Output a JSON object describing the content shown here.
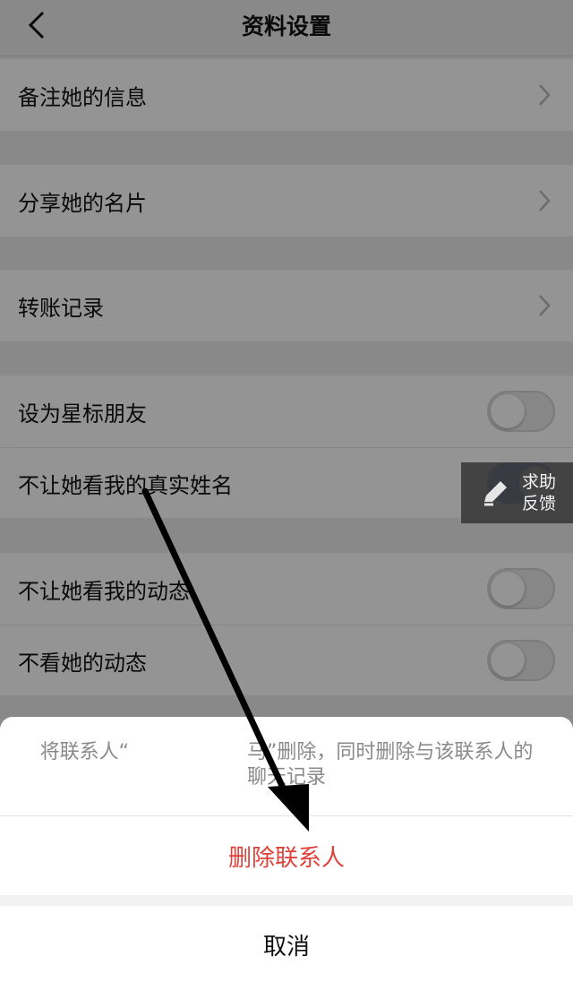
{
  "nav": {
    "title": "资料设置",
    "back_icon": "chevron-left-icon"
  },
  "rows": {
    "remark": "备注她的信息",
    "share_card": "分享她的名片",
    "transfer": "转账记录",
    "star": "设为星标朋友",
    "hide_name": "不让她看我的真实姓名",
    "hide_moments": "不让她看我的动态",
    "no_view_moments": "不看她的动态"
  },
  "toggles": {
    "star": false,
    "hide_name": true,
    "hide_moments": false,
    "no_view_moments": false
  },
  "help": {
    "line1": "求助",
    "line2": "反馈",
    "icon": "pen-icon"
  },
  "sheet": {
    "message": "将联系人“　　　　　　马”删除，同时删除与该联系人的聊天记录",
    "delete_label": "删除联系人",
    "cancel_label": "取消"
  },
  "colors": {
    "danger": "#e0403a",
    "toggle_on": "#1e5fd4"
  }
}
